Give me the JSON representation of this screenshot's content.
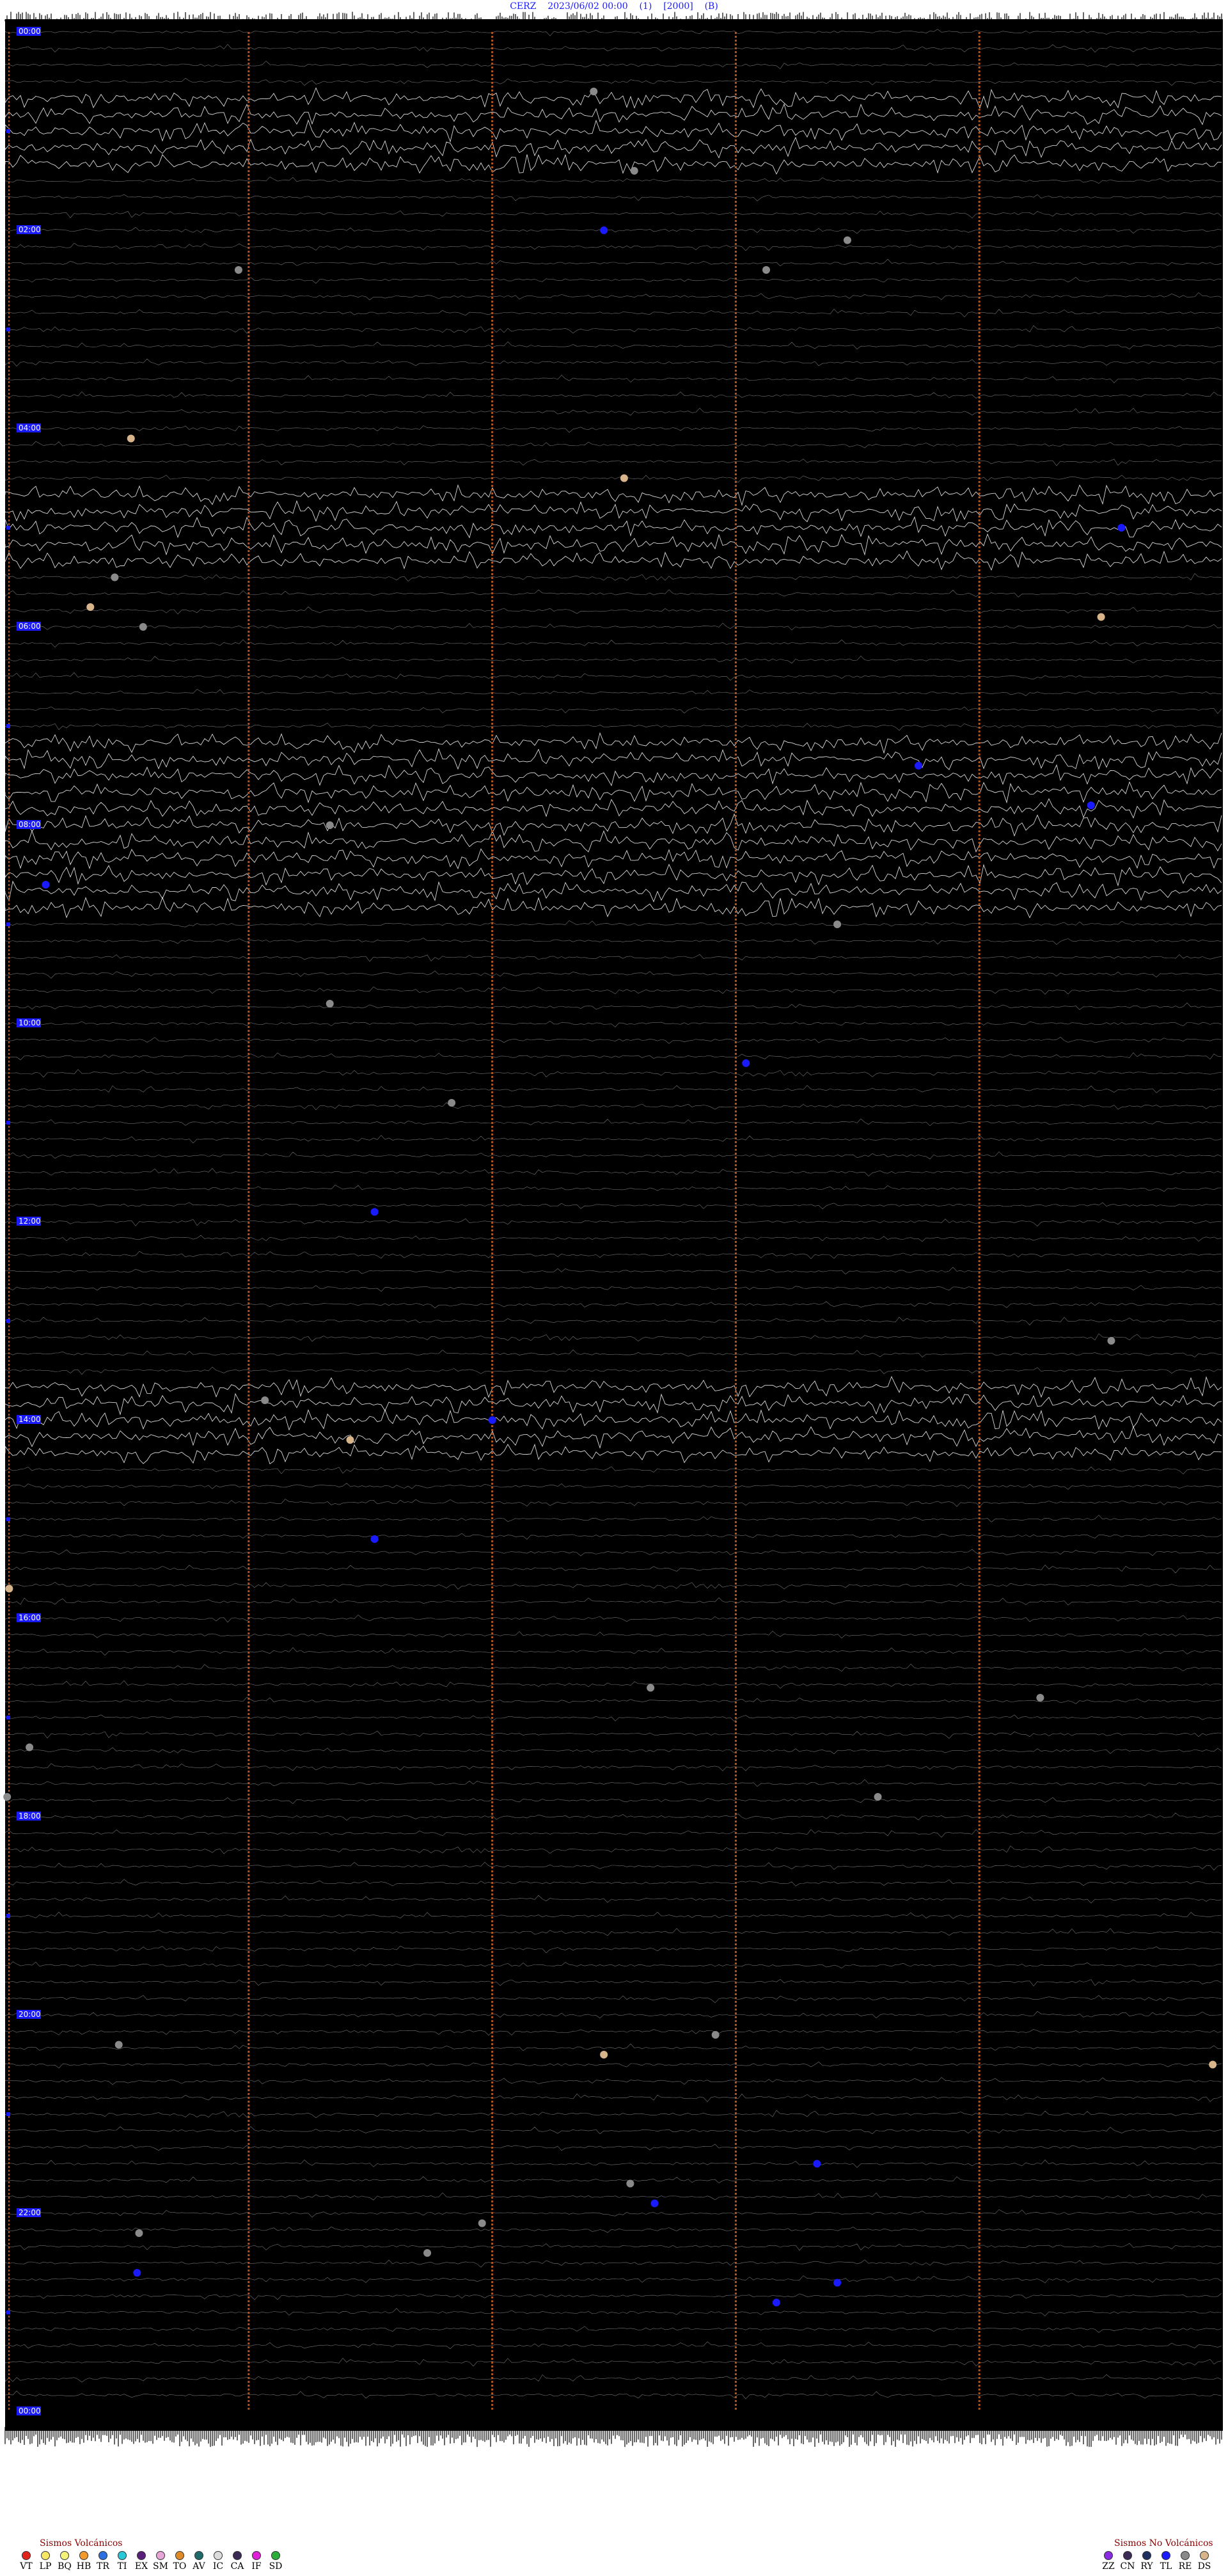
{
  "header": {
    "station": "CERZ",
    "datetime": "2023/06/02 00:00",
    "field1": "(1)",
    "field2": "[2000]",
    "field3": "(B)"
  },
  "chart_data": {
    "type": "scatter",
    "plot_background": "#000000",
    "trace_color": "#ffffff",
    "divider_color": "#b5541f",
    "y_tick_labels": [
      "00:00",
      "02:00",
      "04:00",
      "06:00",
      "08:00",
      "10:00",
      "12:00",
      "14:00",
      "16:00",
      "18:00",
      "20:00",
      "22:00",
      "00:00"
    ],
    "hour_rows": 24,
    "divider_minutes": [
      12,
      24,
      36,
      48
    ],
    "dense_bands_hours": [
      1.0,
      5.0,
      7.5,
      8.0,
      8.6,
      14.0
    ],
    "events": [
      {
        "hour": 0.6,
        "minute": 29.0,
        "type": "RE"
      },
      {
        "hour": 1.4,
        "minute": 31.0,
        "type": "RE"
      },
      {
        "hour": 2.0,
        "minute": 29.5,
        "type": "TL"
      },
      {
        "hour": 2.1,
        "minute": 41.5,
        "type": "RE"
      },
      {
        "hour": 2.4,
        "minute": 11.5,
        "type": "RE"
      },
      {
        "hour": 2.4,
        "minute": 37.5,
        "type": "RE"
      },
      {
        "hour": 4.1,
        "minute": 6.2,
        "type": "DS"
      },
      {
        "hour": 4.5,
        "minute": 30.5,
        "type": "DS"
      },
      {
        "hour": 5.0,
        "minute": 55.0,
        "type": "TL"
      },
      {
        "hour": 5.5,
        "minute": 5.4,
        "type": "RE"
      },
      {
        "hour": 5.8,
        "minute": 4.2,
        "type": "DS"
      },
      {
        "hour": 5.9,
        "minute": 54.0,
        "type": "DS"
      },
      {
        "hour": 6.0,
        "minute": 6.8,
        "type": "RE"
      },
      {
        "hour": 7.4,
        "minute": 45.0,
        "type": "TL"
      },
      {
        "hour": 7.8,
        "minute": 53.5,
        "type": "TL"
      },
      {
        "hour": 8.0,
        "minute": 16.0,
        "type": "RE"
      },
      {
        "hour": 8.6,
        "minute": 2.0,
        "type": "TL"
      },
      {
        "hour": 9.0,
        "minute": 41.0,
        "type": "RE"
      },
      {
        "hour": 9.8,
        "minute": 16.0,
        "type": "RE"
      },
      {
        "hour": 10.4,
        "minute": 36.5,
        "type": "TL"
      },
      {
        "hour": 10.8,
        "minute": 22.0,
        "type": "RE"
      },
      {
        "hour": 11.9,
        "minute": 18.2,
        "type": "TL"
      },
      {
        "hour": 13.2,
        "minute": 54.5,
        "type": "RE"
      },
      {
        "hour": 13.8,
        "minute": 12.8,
        "type": "RE"
      },
      {
        "hour": 14.0,
        "minute": 24.0,
        "type": "TL"
      },
      {
        "hour": 14.2,
        "minute": 17.0,
        "type": "DS"
      },
      {
        "hour": 15.2,
        "minute": 18.2,
        "type": "TL"
      },
      {
        "hour": 15.7,
        "minute": 0.2,
        "type": "DS"
      },
      {
        "hour": 16.7,
        "minute": 31.8,
        "type": "RE"
      },
      {
        "hour": 16.8,
        "minute": 51.0,
        "type": "RE"
      },
      {
        "hour": 17.3,
        "minute": 1.2,
        "type": "RE"
      },
      {
        "hour": 17.8,
        "minute": 0.1,
        "type": "RE"
      },
      {
        "hour": 17.8,
        "minute": 43.0,
        "type": "RE"
      },
      {
        "hour": 20.2,
        "minute": 35.0,
        "type": "RE"
      },
      {
        "hour": 20.3,
        "minute": 5.6,
        "type": "RE"
      },
      {
        "hour": 20.4,
        "minute": 29.5,
        "type": "DS"
      },
      {
        "hour": 20.5,
        "minute": 59.5,
        "type": "DS"
      },
      {
        "hour": 21.5,
        "minute": 40.0,
        "type": "TL"
      },
      {
        "hour": 21.7,
        "minute": 30.8,
        "type": "RE"
      },
      {
        "hour": 21.9,
        "minute": 32.0,
        "type": "TL"
      },
      {
        "hour": 22.1,
        "minute": 23.5,
        "type": "RE"
      },
      {
        "hour": 22.2,
        "minute": 6.6,
        "type": "RE"
      },
      {
        "hour": 22.4,
        "minute": 20.8,
        "type": "RE"
      },
      {
        "hour": 22.6,
        "minute": 6.5,
        "type": "TL"
      },
      {
        "hour": 22.7,
        "minute": 41.0,
        "type": "TL"
      },
      {
        "hour": 22.9,
        "minute": 38.0,
        "type": "TL"
      }
    ]
  },
  "legend_volcanic": {
    "title": "Sismos Volcánicos",
    "items": [
      {
        "code": "VT",
        "color": "#e0241b"
      },
      {
        "code": "LP",
        "color": "#f5e663"
      },
      {
        "code": "BQ",
        "color": "#f3f37a"
      },
      {
        "code": "HB",
        "color": "#f29a2e"
      },
      {
        "code": "TR",
        "color": "#2b6fe0"
      },
      {
        "code": "TI",
        "color": "#29c8d8"
      },
      {
        "code": "EX",
        "color": "#5a1f7a"
      },
      {
        "code": "SM",
        "color": "#e7a4d7"
      },
      {
        "code": "TO",
        "color": "#e08a2a"
      },
      {
        "code": "AV",
        "color": "#1f6b6b"
      },
      {
        "code": "IC",
        "color": "#dddddd"
      },
      {
        "code": "CA",
        "color": "#3a2a55"
      },
      {
        "code": "IF",
        "color": "#e020d8"
      },
      {
        "code": "SD",
        "color": "#2cae3a"
      }
    ]
  },
  "legend_nonvolcanic": {
    "title": "Sismos No Volcánicos",
    "items": [
      {
        "code": "ZZ",
        "color": "#8a2be2"
      },
      {
        "code": "CN",
        "color": "#3a2a55"
      },
      {
        "code": "RY",
        "color": "#1f2f5f"
      },
      {
        "code": "TL",
        "color": "#1a1aff"
      },
      {
        "code": "RE",
        "color": "#8a8a8a"
      },
      {
        "code": "DS",
        "color": "#d8b48a"
      }
    ]
  }
}
